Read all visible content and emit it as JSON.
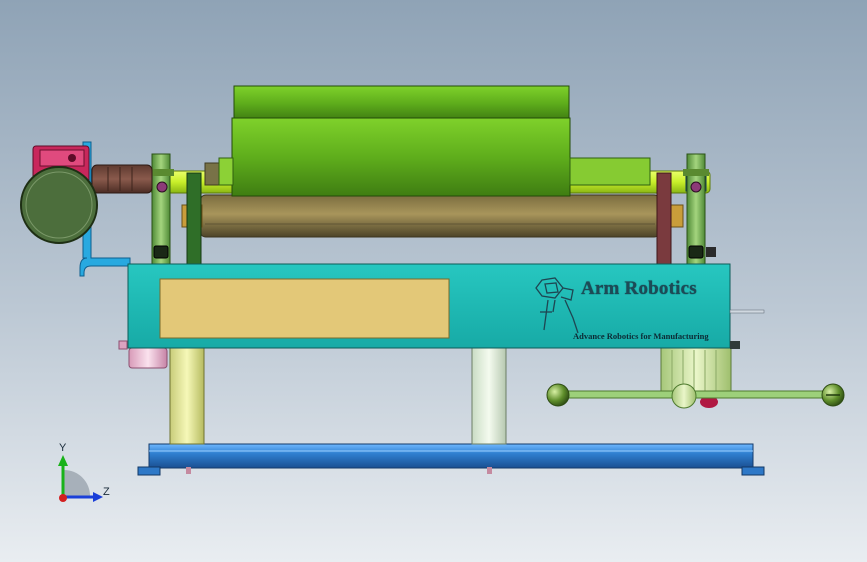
{
  "panel": {
    "brand_name": "Arm Robotics",
    "tagline": "Advance Robotics for Manufacturing"
  },
  "triad": {
    "y_label": "Y",
    "z_label": "Z"
  },
  "colors": {
    "background_top": "#8fa3b6",
    "background_bottom": "#e9edf1",
    "panel_teal": "#1fbcb6",
    "label_plate": "#e3c878",
    "base_blue": "#2f7fd0",
    "green_cover": "#5fb01e",
    "motor_dark_green": "#4b6a3a",
    "motor_red": "#c0245a"
  }
}
